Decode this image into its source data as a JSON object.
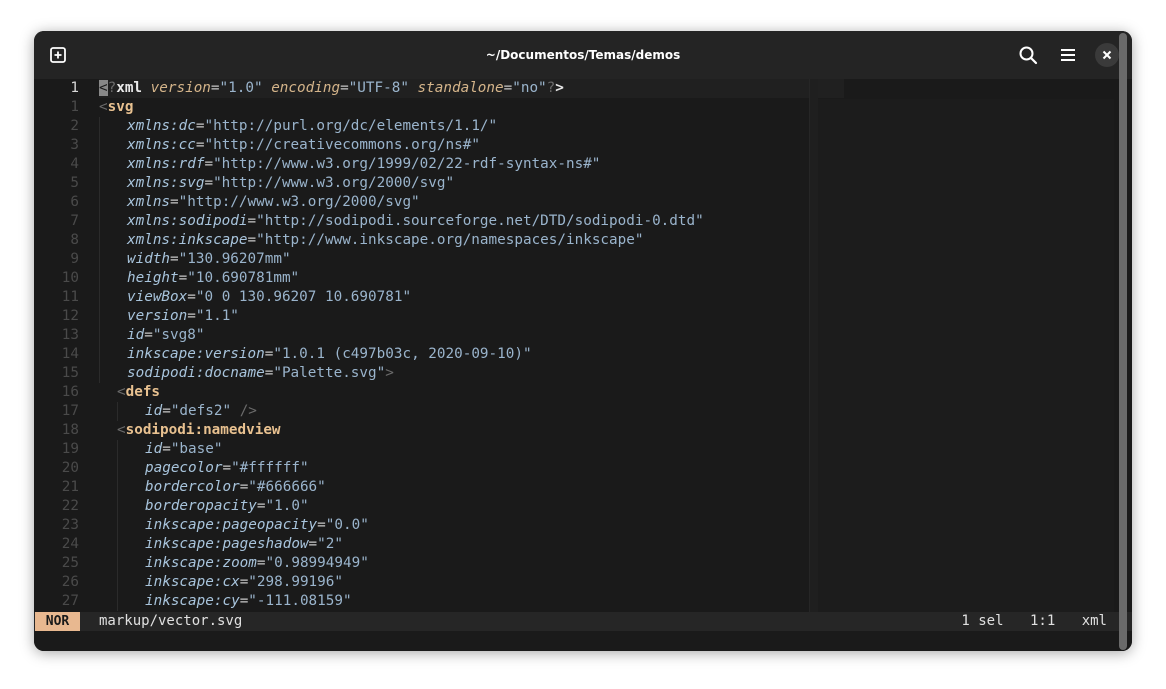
{
  "window": {
    "title": "~/Documentos/Temas/demos",
    "icons": {
      "new_tab": "new-tab-icon",
      "search": "search-icon",
      "menu": "menu-icon",
      "close": "close-icon"
    }
  },
  "colors": {
    "tag": "#e8c190",
    "attribute": "#a8c4dc",
    "string": "#9ab4cc",
    "mode_badge": "#e8b890",
    "background": "#1a1a1a"
  },
  "gutter": [
    "1",
    "1",
    "2",
    "3",
    "4",
    "5",
    "6",
    "7",
    "8",
    "9",
    "10",
    "11",
    "12",
    "13",
    "14",
    "15",
    "16",
    "17",
    "18",
    "19",
    "20",
    "21",
    "22",
    "23",
    "24",
    "25",
    "26",
    "27"
  ],
  "lines": [
    {
      "indent": 0,
      "tokens": [
        [
          "cursor",
          "<"
        ],
        [
          "c-punct",
          "?"
        ],
        [
          "c-decl",
          "xml"
        ],
        [
          "c-eq",
          " "
        ],
        [
          "c-attr2",
          "version"
        ],
        [
          "c-eq",
          "="
        ],
        [
          "c-str",
          "\"1.0\""
        ],
        [
          "c-eq",
          " "
        ],
        [
          "c-attr2",
          "encoding"
        ],
        [
          "c-eq",
          "="
        ],
        [
          "c-str",
          "\"UTF-8\""
        ],
        [
          "c-eq",
          " "
        ],
        [
          "c-attr2",
          "standalone"
        ],
        [
          "c-eq",
          "="
        ],
        [
          "c-str",
          "\"no\""
        ],
        [
          "c-punct",
          "?"
        ],
        [
          "c-decl",
          ">"
        ]
      ]
    },
    {
      "indent": 0,
      "tokens": [
        [
          "c-punct",
          "<"
        ],
        [
          "c-tag",
          "svg"
        ]
      ]
    },
    {
      "indent": 1,
      "tokens": [
        [
          "c-attr",
          "xmlns:dc"
        ],
        [
          "c-eq",
          "="
        ],
        [
          "c-str",
          "\"http://purl.org/dc/elements/1.1/\""
        ]
      ]
    },
    {
      "indent": 1,
      "tokens": [
        [
          "c-attr",
          "xmlns:cc"
        ],
        [
          "c-eq",
          "="
        ],
        [
          "c-str",
          "\"http://creativecommons.org/ns#\""
        ]
      ]
    },
    {
      "indent": 1,
      "tokens": [
        [
          "c-attr",
          "xmlns:rdf"
        ],
        [
          "c-eq",
          "="
        ],
        [
          "c-str",
          "\"http://www.w3.org/1999/02/22-rdf-syntax-ns#\""
        ]
      ]
    },
    {
      "indent": 1,
      "tokens": [
        [
          "c-attr",
          "xmlns:svg"
        ],
        [
          "c-eq",
          "="
        ],
        [
          "c-str",
          "\"http://www.w3.org/2000/svg\""
        ]
      ]
    },
    {
      "indent": 1,
      "tokens": [
        [
          "c-attr",
          "xmlns"
        ],
        [
          "c-eq",
          "="
        ],
        [
          "c-str",
          "\"http://www.w3.org/2000/svg\""
        ]
      ]
    },
    {
      "indent": 1,
      "tokens": [
        [
          "c-attr",
          "xmlns:sodipodi"
        ],
        [
          "c-eq",
          "="
        ],
        [
          "c-str",
          "\"http://sodipodi.sourceforge.net/DTD/sodipodi-0.dtd\""
        ]
      ]
    },
    {
      "indent": 1,
      "tokens": [
        [
          "c-attr",
          "xmlns:inkscape"
        ],
        [
          "c-eq",
          "="
        ],
        [
          "c-str",
          "\"http://www.inkscape.org/namespaces/inkscape\""
        ]
      ]
    },
    {
      "indent": 1,
      "tokens": [
        [
          "c-attr",
          "width"
        ],
        [
          "c-eq",
          "="
        ],
        [
          "c-str",
          "\"130.96207mm\""
        ]
      ]
    },
    {
      "indent": 1,
      "tokens": [
        [
          "c-attr",
          "height"
        ],
        [
          "c-eq",
          "="
        ],
        [
          "c-str",
          "\"10.690781mm\""
        ]
      ]
    },
    {
      "indent": 1,
      "tokens": [
        [
          "c-attr",
          "viewBox"
        ],
        [
          "c-eq",
          "="
        ],
        [
          "c-str",
          "\"0 0 130.96207 10.690781\""
        ]
      ]
    },
    {
      "indent": 1,
      "tokens": [
        [
          "c-attr",
          "version"
        ],
        [
          "c-eq",
          "="
        ],
        [
          "c-str",
          "\"1.1\""
        ]
      ]
    },
    {
      "indent": 1,
      "tokens": [
        [
          "c-attr",
          "id"
        ],
        [
          "c-eq",
          "="
        ],
        [
          "c-str",
          "\"svg8\""
        ]
      ]
    },
    {
      "indent": 1,
      "tokens": [
        [
          "c-attr",
          "inkscape:version"
        ],
        [
          "c-eq",
          "="
        ],
        [
          "c-str",
          "\"1.0.1 (c497b03c, 2020-09-10)\""
        ]
      ]
    },
    {
      "indent": 1,
      "tokens": [
        [
          "c-attr",
          "sodipodi:docname"
        ],
        [
          "c-eq",
          "="
        ],
        [
          "c-str",
          "\"Palette.svg\""
        ],
        [
          "c-punct",
          ">"
        ]
      ]
    },
    {
      "indent": 0.5,
      "tokens": [
        [
          "c-punct",
          "<"
        ],
        [
          "c-tag",
          "defs"
        ]
      ]
    },
    {
      "indent": 1.5,
      "tokens": [
        [
          "c-attr",
          "id"
        ],
        [
          "c-eq",
          "="
        ],
        [
          "c-str",
          "\"defs2\""
        ],
        [
          "c-eq",
          " "
        ],
        [
          "c-punct",
          "/>"
        ]
      ]
    },
    {
      "indent": 0.5,
      "tokens": [
        [
          "c-punct",
          "<"
        ],
        [
          "c-tag",
          "sodipodi:namedview"
        ]
      ]
    },
    {
      "indent": 1.5,
      "tokens": [
        [
          "c-attr",
          "id"
        ],
        [
          "c-eq",
          "="
        ],
        [
          "c-str",
          "\"base\""
        ]
      ]
    },
    {
      "indent": 1.5,
      "tokens": [
        [
          "c-attr",
          "pagecolor"
        ],
        [
          "c-eq",
          "="
        ],
        [
          "c-str",
          "\"#ffffff\""
        ]
      ]
    },
    {
      "indent": 1.5,
      "tokens": [
        [
          "c-attr",
          "bordercolor"
        ],
        [
          "c-eq",
          "="
        ],
        [
          "c-str",
          "\"#666666\""
        ]
      ]
    },
    {
      "indent": 1.5,
      "tokens": [
        [
          "c-attr",
          "borderopacity"
        ],
        [
          "c-eq",
          "="
        ],
        [
          "c-str",
          "\"1.0\""
        ]
      ]
    },
    {
      "indent": 1.5,
      "tokens": [
        [
          "c-attr",
          "inkscape:pageopacity"
        ],
        [
          "c-eq",
          "="
        ],
        [
          "c-str",
          "\"0.0\""
        ]
      ]
    },
    {
      "indent": 1.5,
      "tokens": [
        [
          "c-attr",
          "inkscape:pageshadow"
        ],
        [
          "c-eq",
          "="
        ],
        [
          "c-str",
          "\"2\""
        ]
      ]
    },
    {
      "indent": 1.5,
      "tokens": [
        [
          "c-attr",
          "inkscape:zoom"
        ],
        [
          "c-eq",
          "="
        ],
        [
          "c-str",
          "\"0.98994949\""
        ]
      ]
    },
    {
      "indent": 1.5,
      "tokens": [
        [
          "c-attr",
          "inkscape:cx"
        ],
        [
          "c-eq",
          "="
        ],
        [
          "c-str",
          "\"298.99196\""
        ]
      ]
    },
    {
      "indent": 1.5,
      "tokens": [
        [
          "c-attr",
          "inkscape:cy"
        ],
        [
          "c-eq",
          "="
        ],
        [
          "c-str",
          "\"-111.08159\""
        ]
      ]
    }
  ],
  "status": {
    "mode": "NOR",
    "file": "markup/vector.svg",
    "selection": "1 sel",
    "position": "1:1",
    "language": "xml"
  }
}
